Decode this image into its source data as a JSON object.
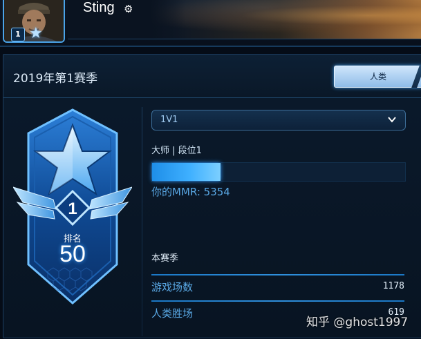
{
  "profile": {
    "name": "Sting",
    "level": "1",
    "settings_icon": "gear-icon"
  },
  "season": {
    "title": "2019年第1赛季",
    "race_tab": "人类"
  },
  "rank": {
    "label": "排名",
    "value": "50",
    "emblem_icon": "master-league-emblem"
  },
  "mode": {
    "selected": "1V1"
  },
  "league": {
    "text": "大师 | 段位1",
    "progress_fraction": 0.27
  },
  "mmr": {
    "text": "你的MMR:  5354"
  },
  "stats": {
    "title": "本赛季",
    "rows": [
      {
        "label": "游戏场数",
        "value": "1178"
      },
      {
        "label": "人类胜场",
        "value": "619"
      }
    ]
  },
  "watermark": "知乎 @ghost1997",
  "colors": {
    "accent": "#3fb0ff",
    "background": "#081422",
    "border": "#1d3f61"
  }
}
